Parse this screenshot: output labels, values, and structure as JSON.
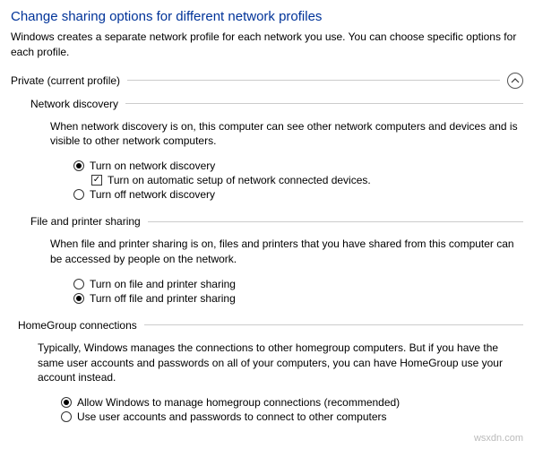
{
  "title": "Change sharing options for different network profiles",
  "subtitle": "Windows creates a separate network profile for each network you use. You can choose specific options for each profile.",
  "profile": {
    "label": "Private (current profile)"
  },
  "sections": {
    "networkDiscovery": {
      "title": "Network discovery",
      "desc": "When network discovery is on, this computer can see other network computers and devices and is visible to other network computers.",
      "opt1": "Turn on network discovery",
      "check1": "Turn on automatic setup of network connected devices.",
      "opt2": "Turn off network discovery"
    },
    "filePrinter": {
      "title": "File and printer sharing",
      "desc": "When file and printer sharing is on, files and printers that you have shared from this computer can be accessed by people on the network.",
      "opt1": "Turn on file and printer sharing",
      "opt2": "Turn off file and printer sharing"
    },
    "homeGroup": {
      "title": "HomeGroup connections",
      "desc": "Typically, Windows manages the connections to other homegroup computers. But if you have the same user accounts and passwords on all of your computers, you can have HomeGroup use your account instead.",
      "opt1": "Allow Windows to manage homegroup connections (recommended)",
      "opt2": "Use user accounts and passwords to connect to other computers"
    }
  },
  "watermark": "wsxdn.com"
}
